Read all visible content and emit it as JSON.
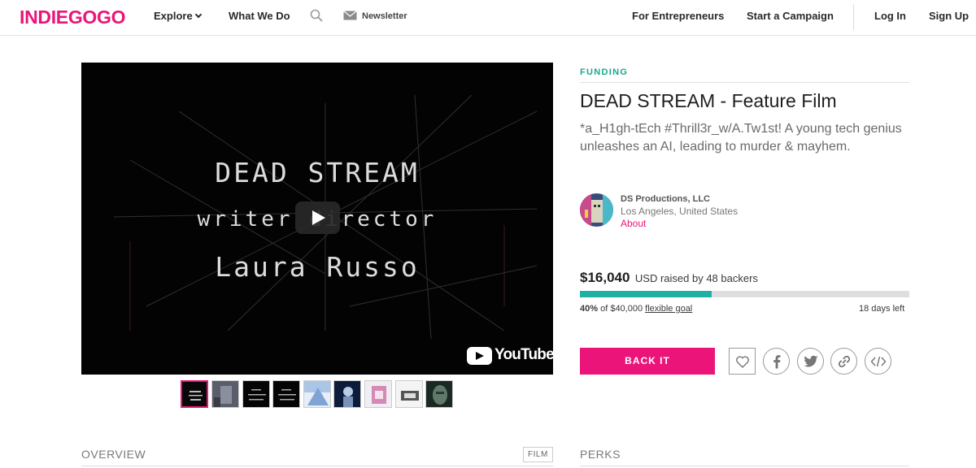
{
  "header": {
    "logo": "INDIEGOGO",
    "nav": {
      "explore": "Explore",
      "what_we_do": "What We Do",
      "newsletter": "Newsletter",
      "for_entrepreneurs": "For Entrepreneurs",
      "start_campaign": "Start a Campaign",
      "log_in": "Log In",
      "sign_up": "Sign Up"
    }
  },
  "video": {
    "line1": "DEAD STREAM",
    "line2": "writer director",
    "line3": "Laura Russo",
    "provider": "YouTube"
  },
  "campaign": {
    "status_label": "FUNDING",
    "title": "DEAD STREAM - Feature Film",
    "tagline": "*a_H1gh-tEch #Thrill3r_w/A.Tw1st! A young tech genius unleashes an AI, leading to murder & mayhem.",
    "owner": {
      "name": "DS Productions, LLC",
      "location": "Los Angeles, United States",
      "about_link": "About"
    },
    "funding": {
      "amount": "$16,040",
      "raised_text": "USD raised by 48 backers",
      "percent_text": "40%",
      "goal_text": "of $40,000",
      "goal_type": "flexible goal",
      "days_left": "18 days left",
      "progress_fraction": 0.4
    },
    "back_button": "BACK IT"
  },
  "tabs": {
    "overview": "OVERVIEW",
    "film_badge": "FILM",
    "perks": "PERKS"
  },
  "colors": {
    "brand": "#eb1478",
    "funding_label": "#1ca68e",
    "progress": "#1fb0a4"
  }
}
